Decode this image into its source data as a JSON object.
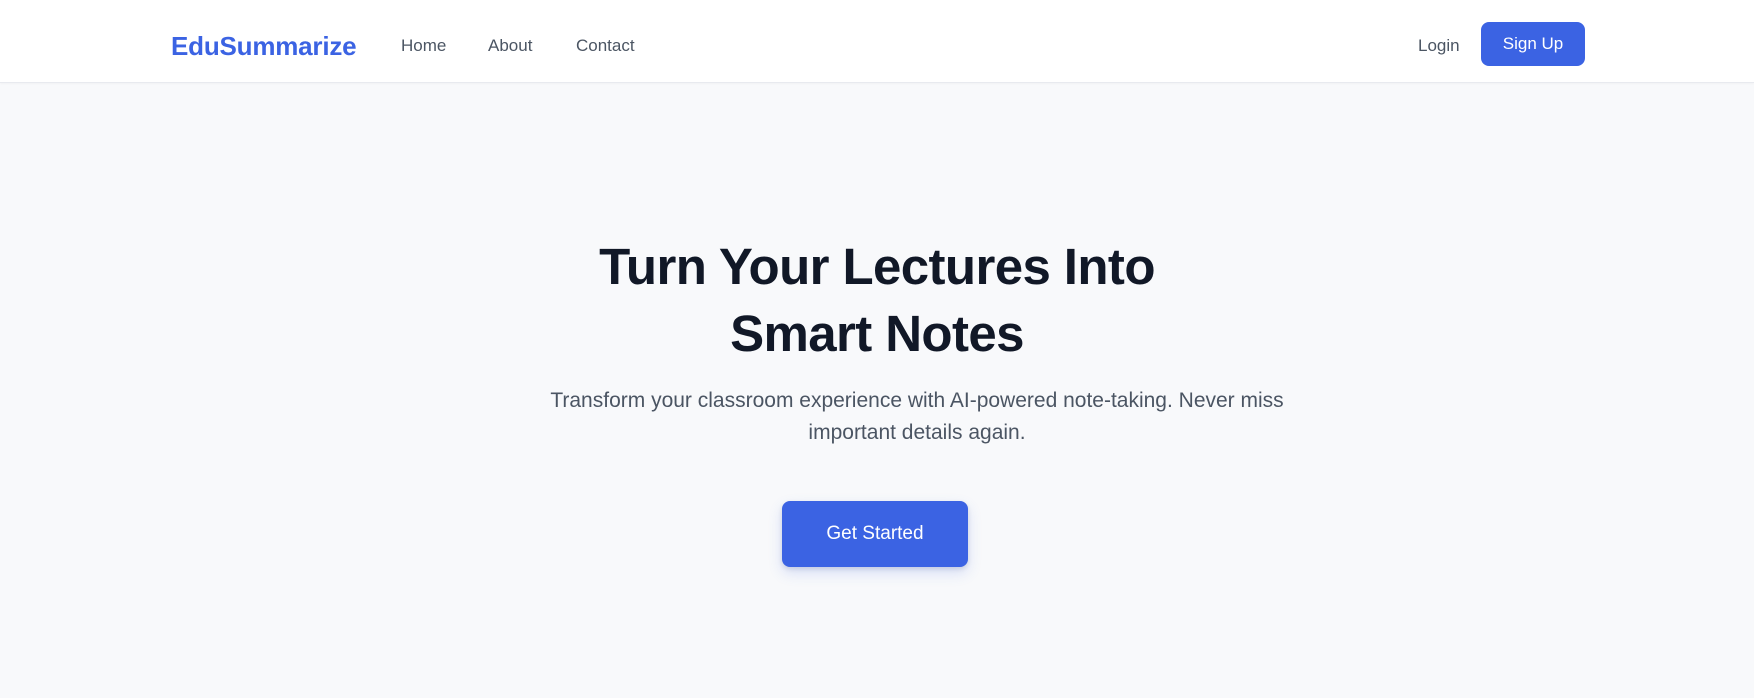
{
  "header": {
    "brand": "EduSummarize",
    "nav": {
      "home": "Home",
      "about": "About",
      "contact": "Contact"
    },
    "auth": {
      "login": "Login",
      "signup": "Sign Up"
    }
  },
  "hero": {
    "title_line_1": "Turn Your Lectures Into",
    "title_line_2": "Smart Notes",
    "subtitle_line_1": "Transform your classroom experience with AI-powered note-taking. Never miss",
    "subtitle_line_2": "important details again.",
    "cta": "Get Started"
  },
  "colors": {
    "primary": "#3B63E3",
    "page_background": "#F8F9FB",
    "header_background": "#FFFFFF",
    "title_text": "#111827",
    "body_text": "#4B5563"
  }
}
